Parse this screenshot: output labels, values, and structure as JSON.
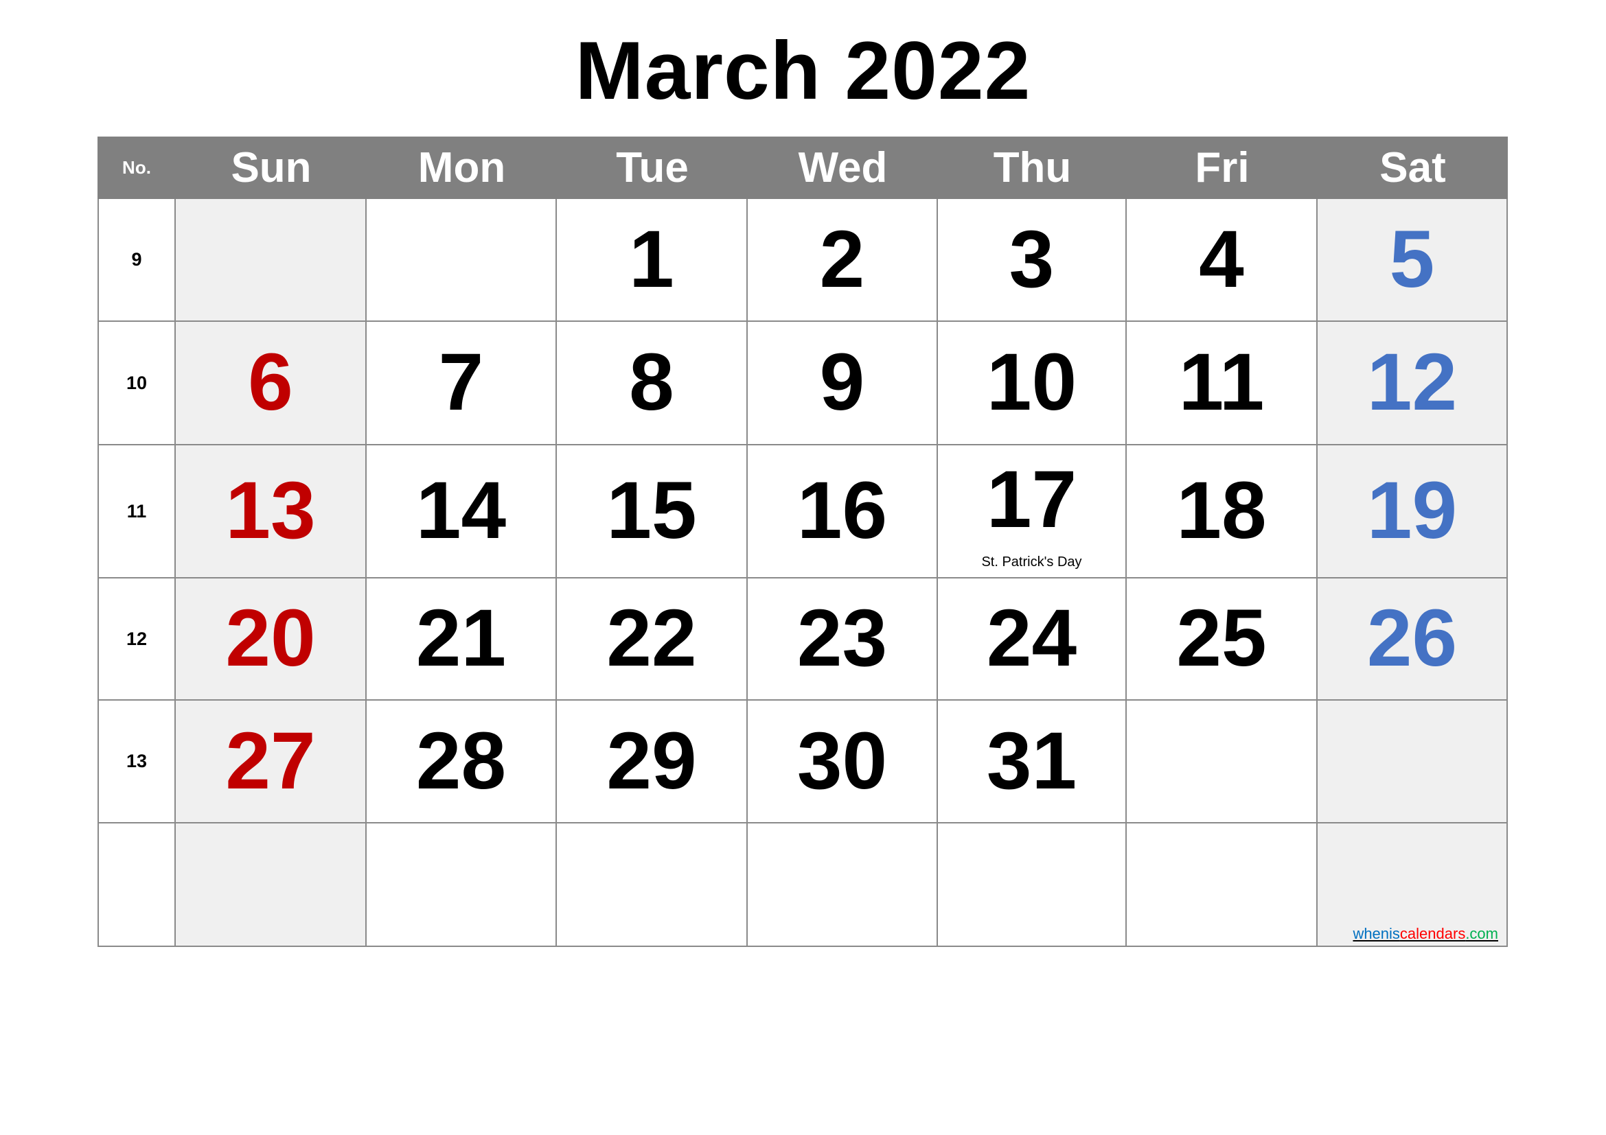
{
  "title": "March 2022",
  "header": {
    "week_no_label": "No.",
    "days": [
      "Sun",
      "Mon",
      "Tue",
      "Wed",
      "Thu",
      "Fri",
      "Sat"
    ]
  },
  "colors": {
    "header_bg": "#808080",
    "header_text": "#FFFFFF",
    "weekend_bg": "#F0F0F0",
    "sunday_text": "#C00000",
    "saturday_text": "#4472C4",
    "weekday_text": "#000000",
    "grid_line": "#8A8A8A"
  },
  "weeks": [
    {
      "no": "9",
      "days": [
        "",
        "",
        "1",
        "2",
        "3",
        "4",
        "5"
      ],
      "notes": [
        "",
        "",
        "",
        "",
        "",
        "",
        ""
      ]
    },
    {
      "no": "10",
      "days": [
        "6",
        "7",
        "8",
        "9",
        "10",
        "11",
        "12"
      ],
      "notes": [
        "",
        "",
        "",
        "",
        "",
        "",
        ""
      ]
    },
    {
      "no": "11",
      "days": [
        "13",
        "14",
        "15",
        "16",
        "17",
        "18",
        "19"
      ],
      "notes": [
        "",
        "",
        "",
        "",
        "St. Patrick's Day",
        "",
        ""
      ]
    },
    {
      "no": "12",
      "days": [
        "20",
        "21",
        "22",
        "23",
        "24",
        "25",
        "26"
      ],
      "notes": [
        "",
        "",
        "",
        "",
        "",
        "",
        ""
      ]
    },
    {
      "no": "13",
      "days": [
        "27",
        "28",
        "29",
        "30",
        "31",
        "",
        ""
      ],
      "notes": [
        "",
        "",
        "",
        "",
        "",
        "",
        ""
      ]
    },
    {
      "no": "",
      "days": [
        "",
        "",
        "",
        "",
        "",
        "",
        ""
      ],
      "notes": [
        "",
        "",
        "",
        "",
        "",
        "",
        ""
      ]
    }
  ],
  "credit": {
    "part1": "whenis",
    "part2": "calendars",
    "part3": ".com",
    "colors": [
      "#0070C0",
      "#FF0000",
      "#00B050"
    ]
  }
}
